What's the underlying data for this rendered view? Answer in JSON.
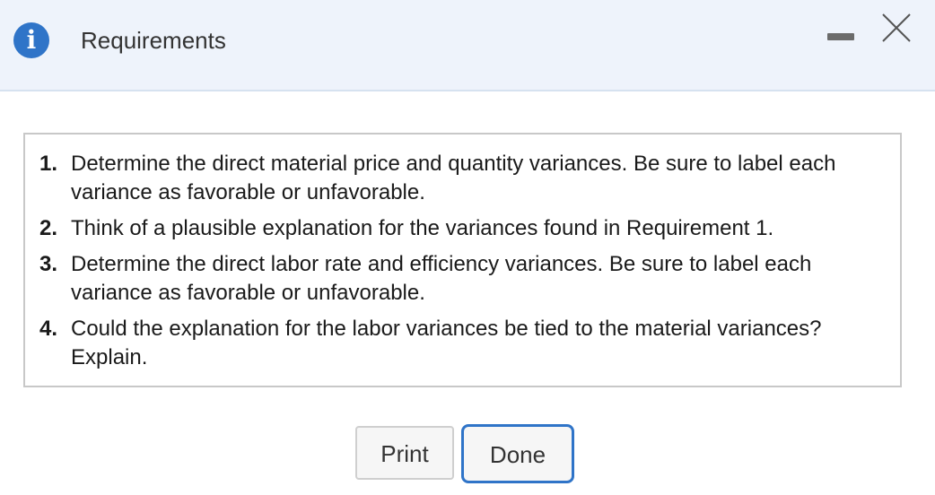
{
  "header": {
    "title": "Requirements",
    "info_icon": "info-icon",
    "minimize_icon": "minimize-icon",
    "close_icon": "close-icon",
    "info_glyph": "i"
  },
  "requirements": [
    {
      "number": "1.",
      "text": "Determine the direct material price and quantity variances. Be sure to label each variance as favorable or unfavorable."
    },
    {
      "number": "2.",
      "text": "Think of a plausible explanation for the variances found in Requirement 1."
    },
    {
      "number": "3.",
      "text": "Determine the direct labor rate and efficiency variances. Be sure to label each variance as favorable or unfavorable."
    },
    {
      "number": "4.",
      "text": "Could the explanation for the labor variances be tied to the material variances? Explain."
    }
  ],
  "footer": {
    "print_label": "Print",
    "done_label": "Done"
  },
  "colors": {
    "header_bg": "#eef3fb",
    "accent": "#2f74c8",
    "border": "#c8c8c8"
  }
}
